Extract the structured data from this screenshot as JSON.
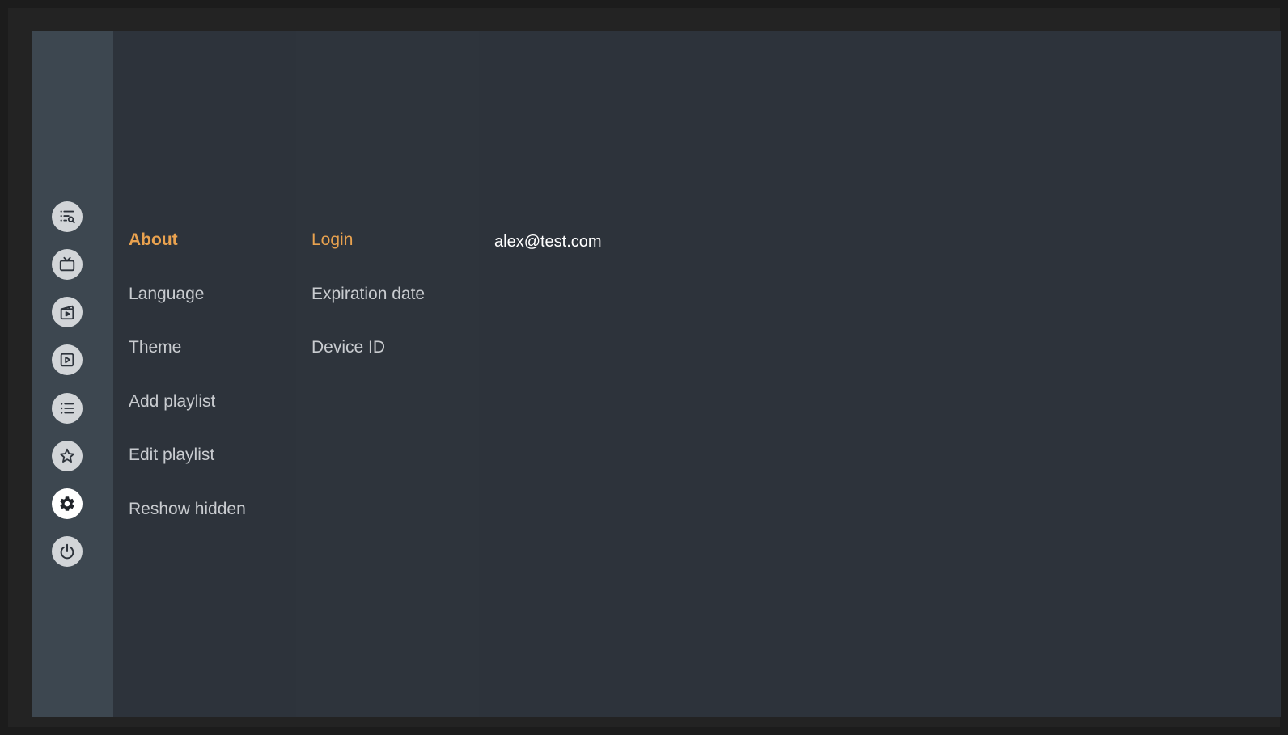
{
  "colors": {
    "accent": "#e9a24f",
    "text": "#c9ccd0",
    "value_text": "#ffffff",
    "rail_bg": "#3d4750",
    "panel_bg": "#2d333b"
  },
  "sidebar": {
    "icons": [
      {
        "name": "search-list-icon"
      },
      {
        "name": "live-tv-icon"
      },
      {
        "name": "movies-icon"
      },
      {
        "name": "series-icon"
      },
      {
        "name": "playlist-icon"
      },
      {
        "name": "favorites-icon"
      },
      {
        "name": "settings-icon",
        "active": true
      },
      {
        "name": "power-icon"
      }
    ]
  },
  "settings_menu": {
    "items": [
      {
        "label": "About",
        "selected": true
      },
      {
        "label": "Language"
      },
      {
        "label": "Theme"
      },
      {
        "label": "Add playlist"
      },
      {
        "label": "Edit playlist"
      },
      {
        "label": "Reshow hidden"
      }
    ]
  },
  "about_menu": {
    "items": [
      {
        "label": "Login",
        "selected": true
      },
      {
        "label": "Expiration date"
      },
      {
        "label": "Device ID"
      }
    ]
  },
  "detail": {
    "value": "alex@test.com"
  }
}
